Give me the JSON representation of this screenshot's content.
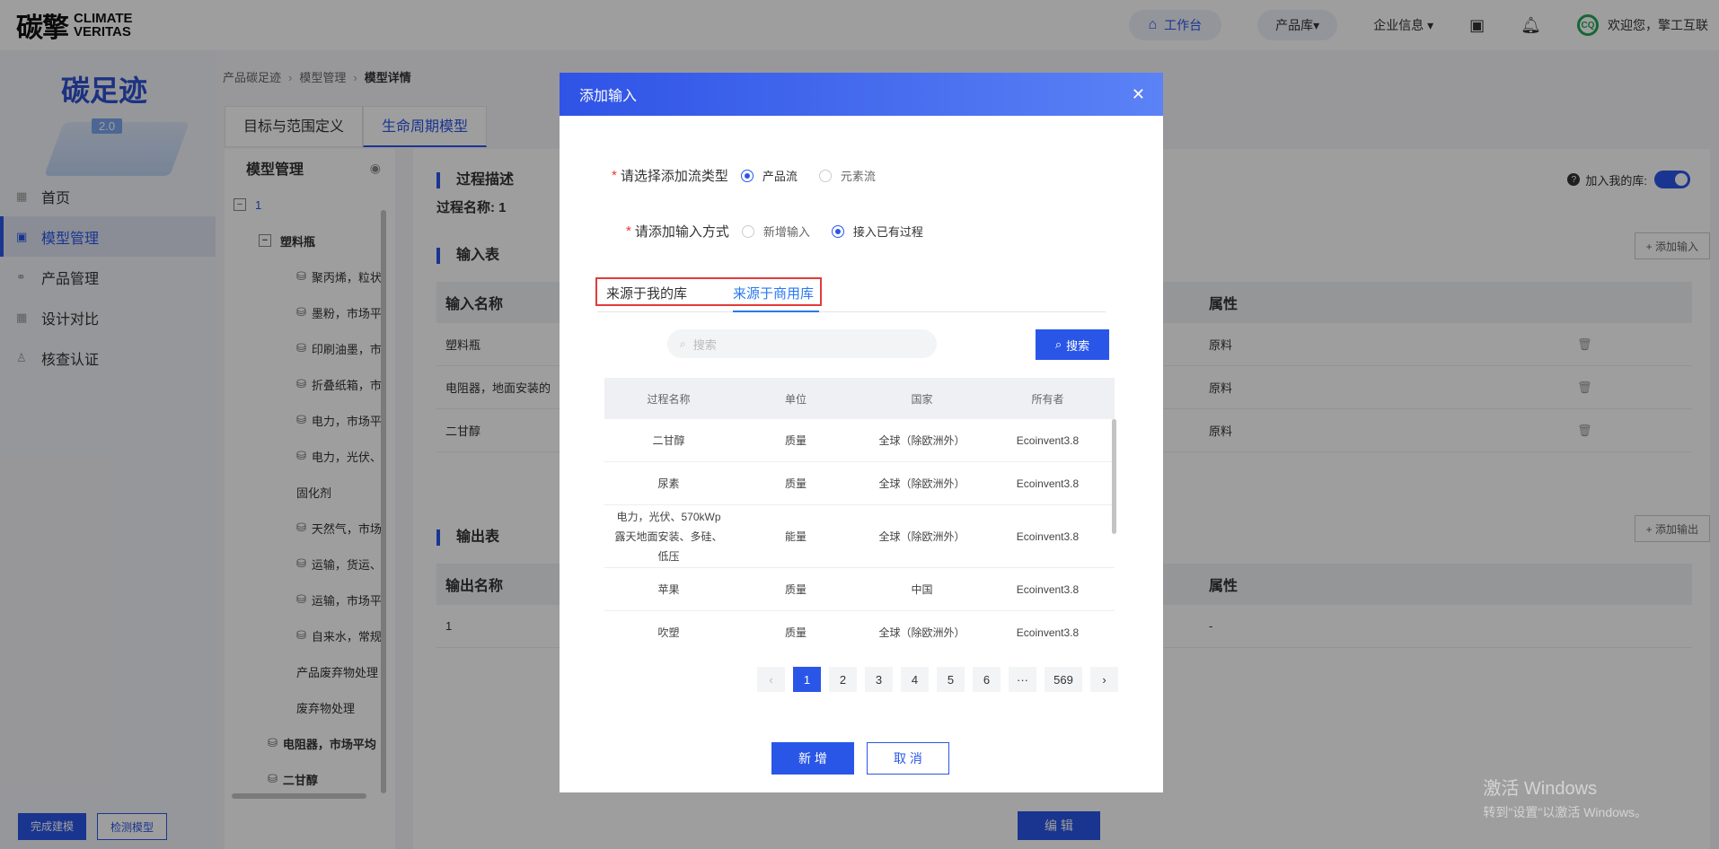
{
  "header": {
    "logo_cn": "碳擎",
    "logo_en_1": "CLIMATE",
    "logo_en_2": "VERITAS",
    "workbench": "工作台",
    "product_lib": "产品库",
    "company_info": "企业信息",
    "welcome": "欢迎您，擎工互联",
    "avatar_text": "CQ"
  },
  "sidebar": {
    "brand_title": "碳足迹",
    "brand_version": "2.0",
    "items": [
      {
        "label": "首页"
      },
      {
        "label": "模型管理"
      },
      {
        "label": "产品管理"
      },
      {
        "label": "设计对比"
      },
      {
        "label": "核查认证"
      }
    ]
  },
  "main": {
    "breadcrumb": [
      "产品碳足迹",
      "模型管理",
      "模型详情"
    ],
    "tabs": [
      "目标与范围定义",
      "生命周期模型"
    ],
    "tree": {
      "title": "模型管理",
      "root": "1",
      "node": "塑料瓶",
      "children": [
        "聚丙烯，粒状",
        "墨粉，市场平",
        "印刷油墨，市",
        "折叠纸箱，市",
        "电力，市场平",
        "电力，光伏、",
        "固化剂",
        "天然气，市场",
        "运输，货运、",
        "运输，市场平",
        "自来水，常规",
        "产品废弃物处理",
        "废弃物处理"
      ],
      "siblings": [
        "电阻器，市场平均",
        "二甘醇"
      ],
      "complete_btn": "完成建模",
      "check_btn": "检测模型"
    },
    "detail": {
      "process_title": "过程描述",
      "process_name": "过程名称: 1",
      "add_to_lib": "加入我的库:",
      "input_title": "输入表",
      "add_input": "+ 添加输入",
      "input_headers": [
        "输入名称",
        "属性"
      ],
      "input_rows": [
        {
          "name": "塑料瓶",
          "attr": "原料"
        },
        {
          "name": "电阻器，地面安装的",
          "attr": "原料"
        },
        {
          "name": "二甘醇",
          "attr": "原料"
        }
      ],
      "output_title": "输出表",
      "add_output": "+ 添加输出",
      "output_headers": [
        "输出名称",
        "属性"
      ],
      "output_rows": [
        {
          "name": "1",
          "attr": "-"
        }
      ],
      "edit_btn": "编 辑"
    }
  },
  "modal": {
    "title": "添加输入",
    "flow_type_label": "请选择添加流类型",
    "flow_type_options": [
      "产品流",
      "元素流"
    ],
    "input_mode_label": "请添加输入方式",
    "input_mode_options": [
      "新增输入",
      "接入已有过程"
    ],
    "source_tabs": [
      "来源于我的库",
      "来源于商用库"
    ],
    "search_placeholder": "搜索",
    "search_btn": "搜索",
    "table_headers": [
      "过程名称",
      "单位",
      "国家",
      "所有者"
    ],
    "rows": [
      {
        "name": "二甘醇",
        "unit": "质量",
        "country": "全球（除欧洲外）",
        "owner": "Ecoinvent3.8"
      },
      {
        "name": "尿素",
        "unit": "质量",
        "country": "全球（除欧洲外）",
        "owner": "Ecoinvent3.8"
      },
      {
        "name": "电力，光伏、570kWp露天地面安装、多硅、低压",
        "unit": "能量",
        "country": "全球（除欧洲外）",
        "owner": "Ecoinvent3.8"
      },
      {
        "name": "苹果",
        "unit": "质量",
        "country": "中国",
        "owner": "Ecoinvent3.8"
      },
      {
        "name": "吹塑",
        "unit": "质量",
        "country": "全球（除欧洲外）",
        "owner": "Ecoinvent3.8"
      }
    ],
    "pages": [
      "1",
      "2",
      "3",
      "4",
      "5",
      "6",
      "···",
      "569"
    ],
    "confirm_btn": "新 增",
    "cancel_btn": "取 消"
  },
  "watermark": {
    "line1": "激活 Windows",
    "line2": "转到\"设置\"以激活 Windows。"
  }
}
